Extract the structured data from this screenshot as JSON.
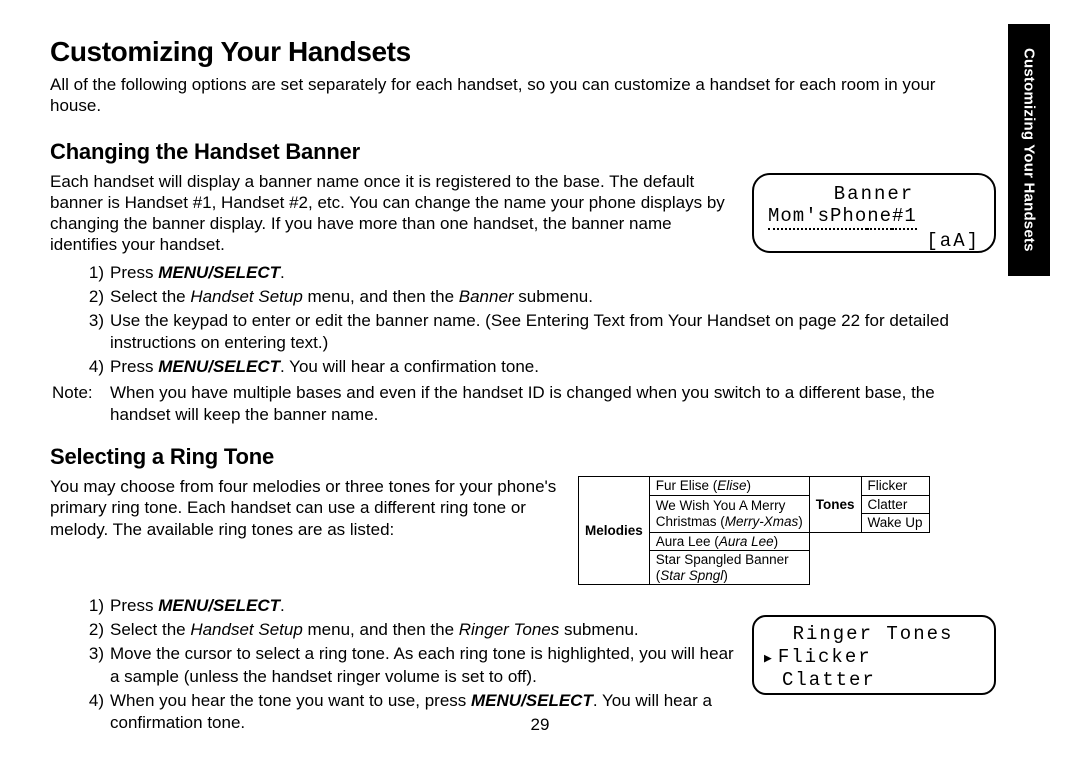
{
  "sideTab": "Customizing Your Handsets",
  "pageNumber": "29",
  "title": "Customizing Your Handsets",
  "intro": "All of the following options are set separately for each handset, so you can customize a handset for each room in your house.",
  "section1": {
    "heading": "Changing the Handset Banner",
    "para": "Each handset will display a banner name once it is registered to the base. The default banner is Handset #1, Handset #2, etc. You can change the name your phone displays by changing the banner display. If you have more than one handset, the banner name identifies your handset.",
    "steps": {
      "n1": "1)",
      "t1a": "Press ",
      "t1b": "MENU/SELECT",
      "t1c": ".",
      "n2": "2)",
      "t2a": "Select the ",
      "t2b": "Handset Setup",
      "t2c": " menu, and then the ",
      "t2d": "Banner",
      "t2e": " submenu.",
      "n3": "3)",
      "t3": "Use the keypad to enter or edit the banner name. (See Entering Text from Your Handset on page 22 for detailed instructions on entering text.)",
      "n4": "4)",
      "t4a": "Press ",
      "t4b": "MENU/SELECT",
      "t4c": ". You will hear a confirmation tone."
    },
    "noteLabel": "Note:",
    "noteText": "When you have multiple bases and even if the handset ID is changed when you switch to a different base, the handset will keep the banner name.",
    "lcd": {
      "l1": "Banner",
      "l2a": "Mom'sPho",
      "l2b": "ne",
      "l2c": " #1",
      "l3": "[aA]"
    }
  },
  "section2": {
    "heading": "Selecting a Ring Tone",
    "para": "You may choose from four melodies or three tones for your phone's primary ring tone. Each handset can use a different ring tone or melody. The available ring tones are as listed:",
    "table": {
      "melodiesHdr": "Melodies",
      "m1a": "Fur Elise (",
      "m1b": "Elise",
      "m1c": ")",
      "m2a": "We Wish You A Merry",
      "m2b": "Christmas (",
      "m2c": "Merry-Xmas",
      "m2d": ")",
      "m3a": "Aura Lee (",
      "m3b": "Aura Lee",
      "m3c": ")",
      "m4a": "Star Spangled Banner",
      "m4b": "(",
      "m4c": "Star Spngl",
      "m4d": ")",
      "tonesHdr": "Tones",
      "t1": "Flicker",
      "t2": "Clatter",
      "t3": "Wake Up"
    },
    "steps": {
      "n1": "1)",
      "t1a": "Press ",
      "t1b": "MENU/SELECT",
      "t1c": ".",
      "n2": "2)",
      "t2a": "Select the ",
      "t2b": "Handset Setup",
      "t2c": " menu, and then the ",
      "t2d": "Ringer Tones",
      "t2e": " submenu.",
      "n3": "3)",
      "t3": "Move the cursor to select a ring tone. As each ring tone is highlighted, you will hear a sample (unless the handset ringer volume is set to off).",
      "n4": "4)",
      "t4a": "When you hear the tone you want to use, press ",
      "t4b": "MENU/SELECT",
      "t4c": ". You will hear a confirmation tone."
    },
    "lcd": {
      "l1": "Ringer Tones",
      "l2": "Flicker",
      "l3": "Clatter"
    }
  }
}
